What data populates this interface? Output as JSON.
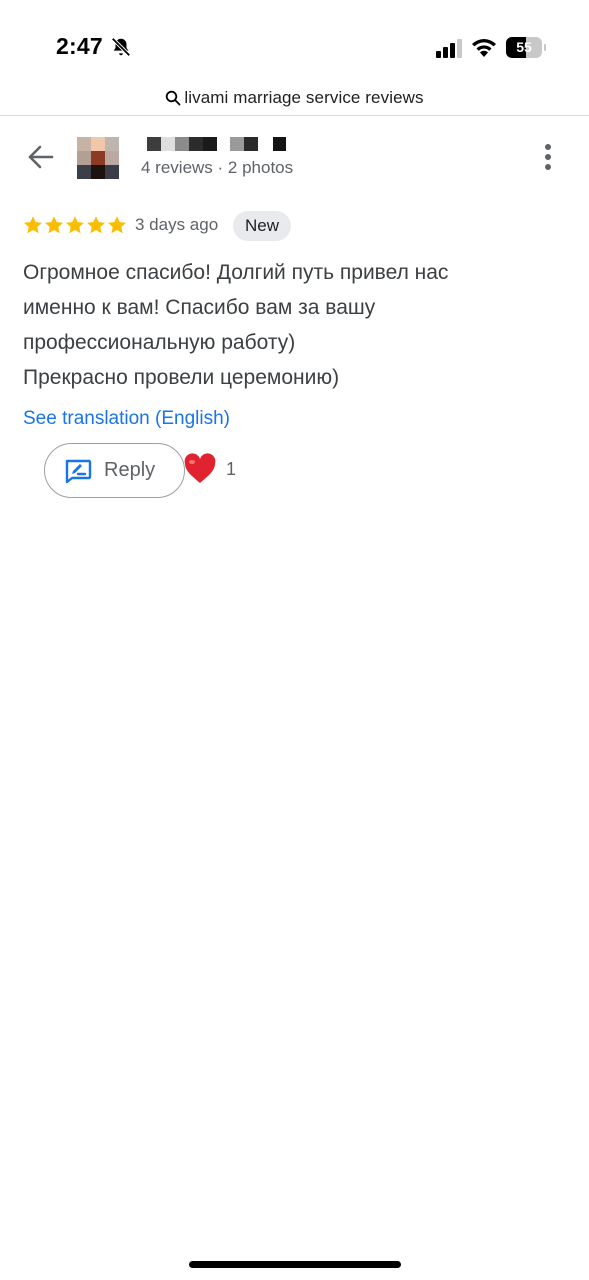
{
  "status_bar": {
    "time": "2:47",
    "battery_level": "55",
    "battery_fraction": 0.55,
    "icons": [
      "bell-off-icon",
      "cellular-signal-icon",
      "wifi-icon",
      "battery-icon"
    ]
  },
  "search": {
    "icon": "search-icon",
    "query": "livami marriage service reviews"
  },
  "review": {
    "reviewer_meta": "4 reviews · 2 photos",
    "rating": 5,
    "star_color": "#fbbc04",
    "date": "3 days ago",
    "badge": "New",
    "text_lines": [
      "Огромное спасибо! Долгий путь привел нас",
      "именно к вам! Спасибо вам за вашу",
      "профессиональную работу)",
      "Прекрасно провели церемонию)"
    ],
    "translation_link": "See translation (English)",
    "reply_label": "Reply",
    "reaction_emoji": "heart-icon",
    "reaction_count": "1"
  },
  "colors": {
    "accent": "#1a73e8",
    "secondary_text": "#5f6368",
    "badge_bg": "#e8eaed",
    "divider": "#dadce0"
  }
}
